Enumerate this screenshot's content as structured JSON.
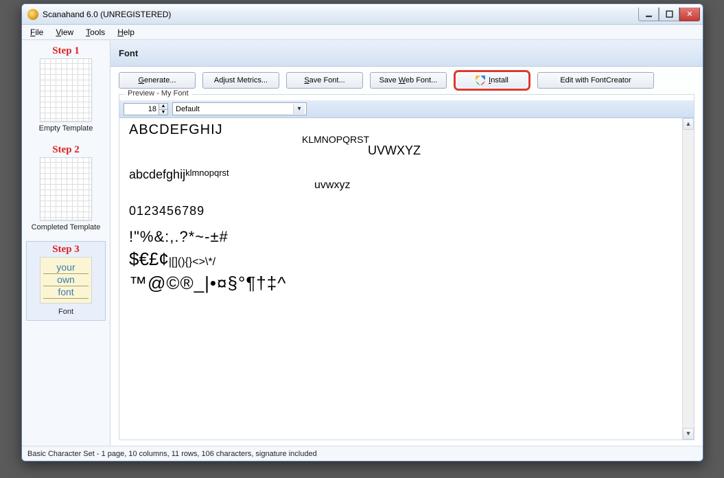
{
  "title": "Scanahand 6.0 (UNREGISTERED)",
  "menubar": [
    "File",
    "View",
    "Tools",
    "Help"
  ],
  "sidebar": {
    "steps": [
      {
        "title": "Step 1",
        "label": "Empty Template"
      },
      {
        "title": "Step 2",
        "label": "Completed Template"
      },
      {
        "title": "Step 3",
        "label": "Font",
        "yo_lines": [
          "your",
          "own",
          "font"
        ]
      }
    ]
  },
  "section_header": "Font",
  "toolbar": {
    "generate": "Generate...",
    "adjust": "Adjust Metrics...",
    "save": "Save Font...",
    "saveweb": "Save Web Font...",
    "install": "Install",
    "edit": "Edit with FontCreator"
  },
  "preview": {
    "legend": "Preview - My Font",
    "font_size": "18",
    "dropdown": "Default",
    "lines": {
      "upper1": "ABCDEFGHIJ",
      "upper2": "KLMNOPQRST",
      "upper3": "UVWXYZ",
      "lower1": "abcdefghij",
      "lower2": "klmnopqrst",
      "lower3": "uvwxyz",
      "digits": "0123456789",
      "sym1": "!\"%&:,.?*~-±#",
      "sym2": "$€£¢",
      "sym2b": "|[](){}<>\\*/",
      "sym3": "™@©®_|•¤§°¶†‡^"
    }
  },
  "status": "Basic Character Set - 1 page, 10 columns, 11 rows, 106 characters, signature included"
}
